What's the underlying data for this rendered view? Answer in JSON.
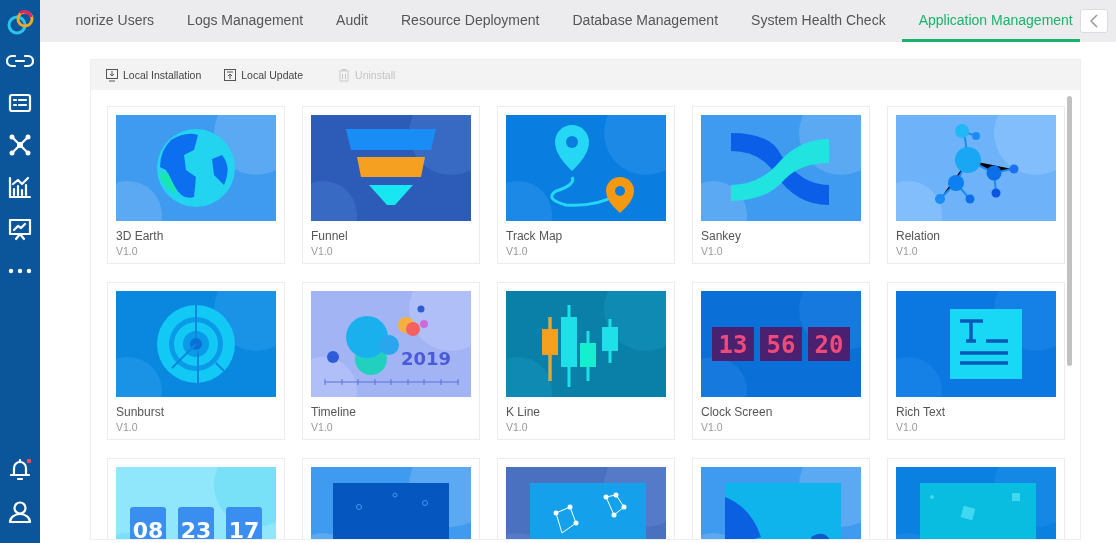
{
  "tabs": [
    {
      "label": "norize Users",
      "selected": false
    },
    {
      "label": "Logs Management",
      "selected": false
    },
    {
      "label": "Audit",
      "selected": false
    },
    {
      "label": "Resource Deployment",
      "selected": false
    },
    {
      "label": "Database Management",
      "selected": false
    },
    {
      "label": "System Health Check",
      "selected": false
    },
    {
      "label": "Application Management",
      "selected": true
    }
  ],
  "toolbar": [
    {
      "label": "Local Installation",
      "kind": "install",
      "disabled": false
    },
    {
      "label": "Local Update",
      "kind": "update",
      "disabled": false
    },
    {
      "label": "Uninstall",
      "kind": "uninstall",
      "disabled": true
    }
  ],
  "apps": [
    {
      "name": "3D Earth",
      "version": "V1.0",
      "kind": "earth"
    },
    {
      "name": "Funnel",
      "version": "V1.0",
      "kind": "funnel"
    },
    {
      "name": "Track Map",
      "version": "V1.0",
      "kind": "trackmap"
    },
    {
      "name": "Sankey",
      "version": "V1.0",
      "kind": "sankey"
    },
    {
      "name": "Relation",
      "version": "V1.0",
      "kind": "relation"
    },
    {
      "name": "Sunburst",
      "version": "V1.0",
      "kind": "sunburst"
    },
    {
      "name": "Timeline",
      "version": "V1.0",
      "kind": "timeline",
      "texts": [
        "2019"
      ]
    },
    {
      "name": "K Line",
      "version": "V1.0",
      "kind": "kline"
    },
    {
      "name": "Clock Screen",
      "version": "V1.0",
      "kind": "clock",
      "texts": [
        "13",
        "56",
        "20"
      ]
    },
    {
      "name": "Rich Text",
      "version": "V1.0",
      "kind": "richtext"
    },
    {
      "kind": "countdown",
      "texts": [
        "08",
        "23",
        "17"
      ]
    },
    {
      "kind": "dots"
    },
    {
      "kind": "network"
    },
    {
      "kind": "wave"
    },
    {
      "kind": "squares"
    }
  ]
}
